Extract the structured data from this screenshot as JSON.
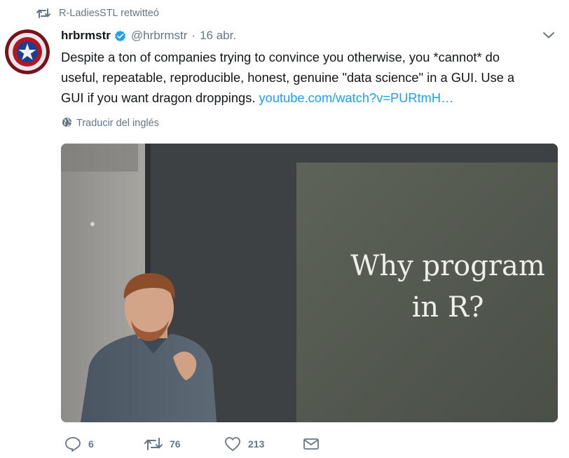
{
  "retweet_context": {
    "label": "R-LadiesSTL retwitteó",
    "icon": "retweet-icon"
  },
  "tweet": {
    "author_name": "hrbrmstr",
    "verified": true,
    "handle": "@hrbrmstr",
    "separator": "·",
    "date": "16 abr.",
    "text_lines": [
      "Despite a ton of companies trying to convince you otherwise, you *cannot* do",
      "useful, repeatable, reproducible, honest, genuine \"data science\" in a GUI. Use a",
      "GUI if you want dragon droppings. "
    ],
    "link": "youtube.com/watch?v=PURtmH…",
    "translate_label": "Traducir del inglés"
  },
  "media": {
    "slide_lines": [
      "Why program",
      "in R?"
    ]
  },
  "actions": {
    "reply_count": "6",
    "retweet_count": "76",
    "like_count": "213"
  },
  "colors": {
    "link": "#1da1f2",
    "secondary_text": "#657786",
    "verified_badge": "#1da1f2"
  }
}
